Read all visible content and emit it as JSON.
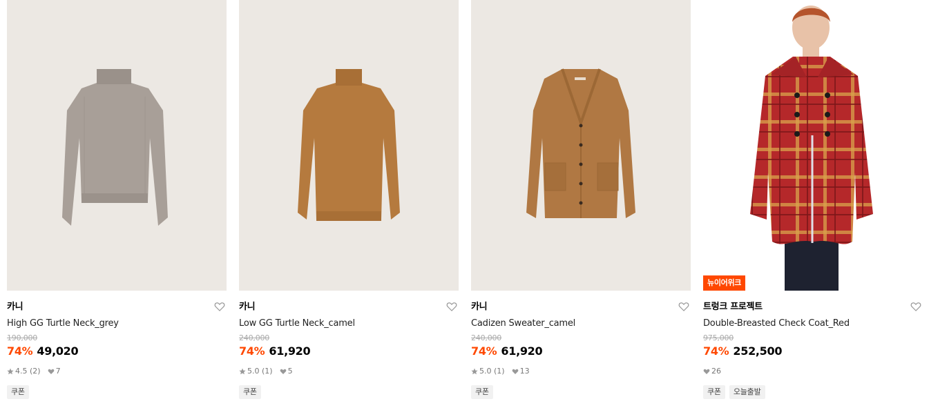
{
  "colors": {
    "discount": "#ff4800",
    "badge_bg": "#ff4800",
    "placeholder_bg": "#ece8e3"
  },
  "products": [
    {
      "brand": "카니",
      "name": "High GG Turtle Neck_grey",
      "original_price": "190,000",
      "discount": "74%",
      "price": "49,020",
      "rating": "4.5 (2)",
      "likes": "7",
      "tags": [
        "쿠폰"
      ],
      "badge": "",
      "image_icon": "turtleneck-sweater-grey"
    },
    {
      "brand": "카니",
      "name": "Low GG Turtle Neck_camel",
      "original_price": "240,000",
      "discount": "74%",
      "price": "61,920",
      "rating": "5.0 (1)",
      "likes": "5",
      "tags": [
        "쿠폰"
      ],
      "badge": "",
      "image_icon": "turtleneck-sweater-camel"
    },
    {
      "brand": "카니",
      "name": "Cadizen Sweater_camel",
      "original_price": "240,000",
      "discount": "74%",
      "price": "61,920",
      "rating": "5.0 (1)",
      "likes": "13",
      "tags": [
        "쿠폰"
      ],
      "badge": "",
      "image_icon": "cardigan-camel"
    },
    {
      "brand": "트렁크 프로젝트",
      "name": "Double-Breasted Check Coat_Red",
      "original_price": "975,000",
      "discount": "74%",
      "price": "252,500",
      "rating": "",
      "likes": "26",
      "tags": [
        "쿠폰",
        "오늘출발"
      ],
      "badge": "뉴이어위크",
      "image_icon": "model-red-check-coat"
    }
  ]
}
